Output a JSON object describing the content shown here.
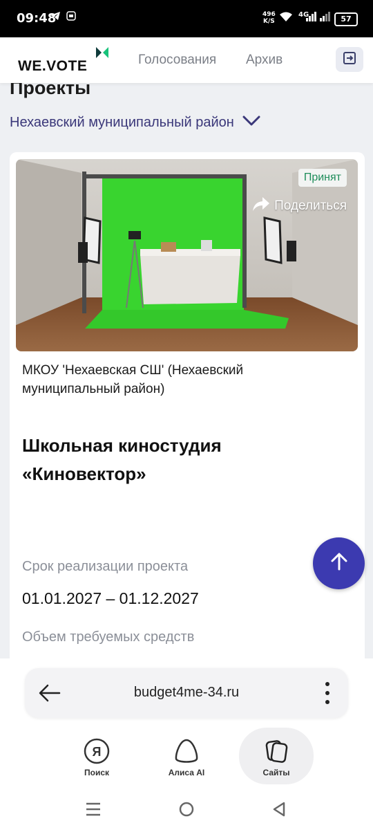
{
  "status_bar": {
    "time": "09:48",
    "net_speed_value": "496",
    "net_speed_unit": "K/S",
    "network": "4G",
    "battery": "57"
  },
  "header": {
    "logo": "WE.VOTE",
    "nav": [
      "Голосования",
      "Архив"
    ]
  },
  "page": {
    "title": "Проекты",
    "region": "Нехаевский муниципальный район"
  },
  "card": {
    "status_badge": "Принят",
    "share_label": "Поделиться",
    "organization": "МКОУ 'Нехаевская СШ' (Нехаевский муниципальный район)",
    "title": "Школьная киностудия «Киновектор»",
    "period_label": "Срок реализации проекта",
    "period_value": "01.01.2027 – 01.12.2027",
    "funds_label": "Объем требуемых средств"
  },
  "browser": {
    "url": "budget4me-34.ru",
    "tabs": [
      {
        "label": "Поиск",
        "icon": "yandex-icon"
      },
      {
        "label": "Алиса AI",
        "icon": "alice-icon"
      },
      {
        "label": "Сайты",
        "icon": "tabs-icon"
      }
    ]
  },
  "colors": {
    "accent": "#3c3ab0",
    "nav_text": "#7b7f87",
    "badge_green": "#1e8d5a",
    "region_text": "#3a3779"
  }
}
